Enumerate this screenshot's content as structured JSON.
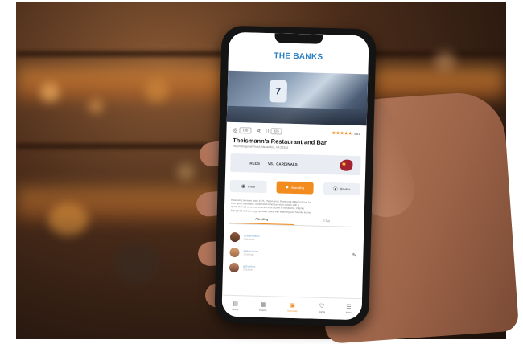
{
  "app": {
    "title": "THE BANKS",
    "jersey_number": "7"
  },
  "actions": {
    "views_count": "100",
    "bookmark_count": "125",
    "rating_value": "4.91",
    "stars": "★★★★★"
  },
  "venue": {
    "name": "Theismann's Restaurant and Bar",
    "address": "20424 Diagonal Road, Alexandria, VA 22314"
  },
  "matchup": {
    "team1": "REDS",
    "vs": "VS.",
    "team2": "CARDINALS"
  },
  "buttons": {
    "left": "Invite",
    "center": "Attending",
    "right": "Review"
  },
  "description": {
    "lines": [
      "Reserving Services since 1975, Theismann's Restaurant & Bar is proud to",
      "offer good, affordable, customized American-style cuisine with a",
      "sports-themed environment at the intersection of Alexandria, Virginia",
      "Enjoy food and beverage specials, along with watching your favorite teams."
    ]
  },
  "tabs": [
    {
      "label": "Attending"
    },
    {
      "label": "Chat"
    }
  ],
  "attendees": [
    {
      "name": "@JulieSantore",
      "sub": "Cincinnati"
    },
    {
      "name": "@MikeJordan",
      "sub": "Cincinnati"
    },
    {
      "name": "@DanSims",
      "sub": "Cincinnati"
    }
  ],
  "nav": [
    {
      "label": "Home",
      "icon": "home-icon"
    },
    {
      "label": "Events",
      "icon": "calendar-grid-icon"
    },
    {
      "label": "Schedule",
      "icon": "calendar-icon"
    },
    {
      "label": "Teams",
      "icon": "shield-icon"
    },
    {
      "label": "More",
      "icon": "menu-icon"
    }
  ],
  "colors": {
    "brand_blue": "#2a7fc0",
    "accent_orange": "#f28c1e"
  }
}
